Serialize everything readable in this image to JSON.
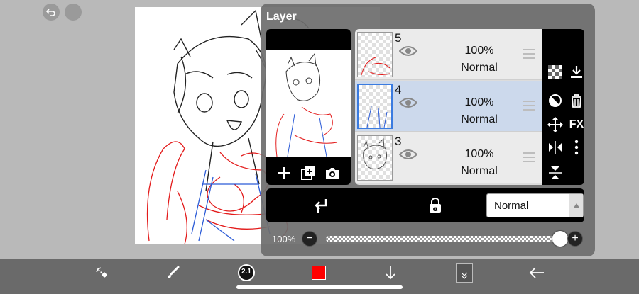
{
  "panel": {
    "title": "Layer"
  },
  "layers": [
    {
      "number": "5",
      "opacity": "100%",
      "blend": "Normal"
    },
    {
      "number": "4",
      "opacity": "100%",
      "blend": "Normal"
    },
    {
      "number": "3",
      "opacity": "100%",
      "blend": "Normal"
    }
  ],
  "blend_select": {
    "value": "Normal"
  },
  "opacity": {
    "label": "100%",
    "value": 1.0
  },
  "colors": {
    "current_color": "#ff0000",
    "selection": "#ccd9ec",
    "accent": "#3a7be0"
  },
  "toolbar": {
    "brush_size": "2.1",
    "icons": [
      "selection-tool-icon",
      "brush-icon",
      "brush-size-icon",
      "color-swatch",
      "download-icon",
      "layer-menu-icon",
      "back-arrow-icon"
    ]
  },
  "tools": {
    "fx_label": "FX"
  }
}
